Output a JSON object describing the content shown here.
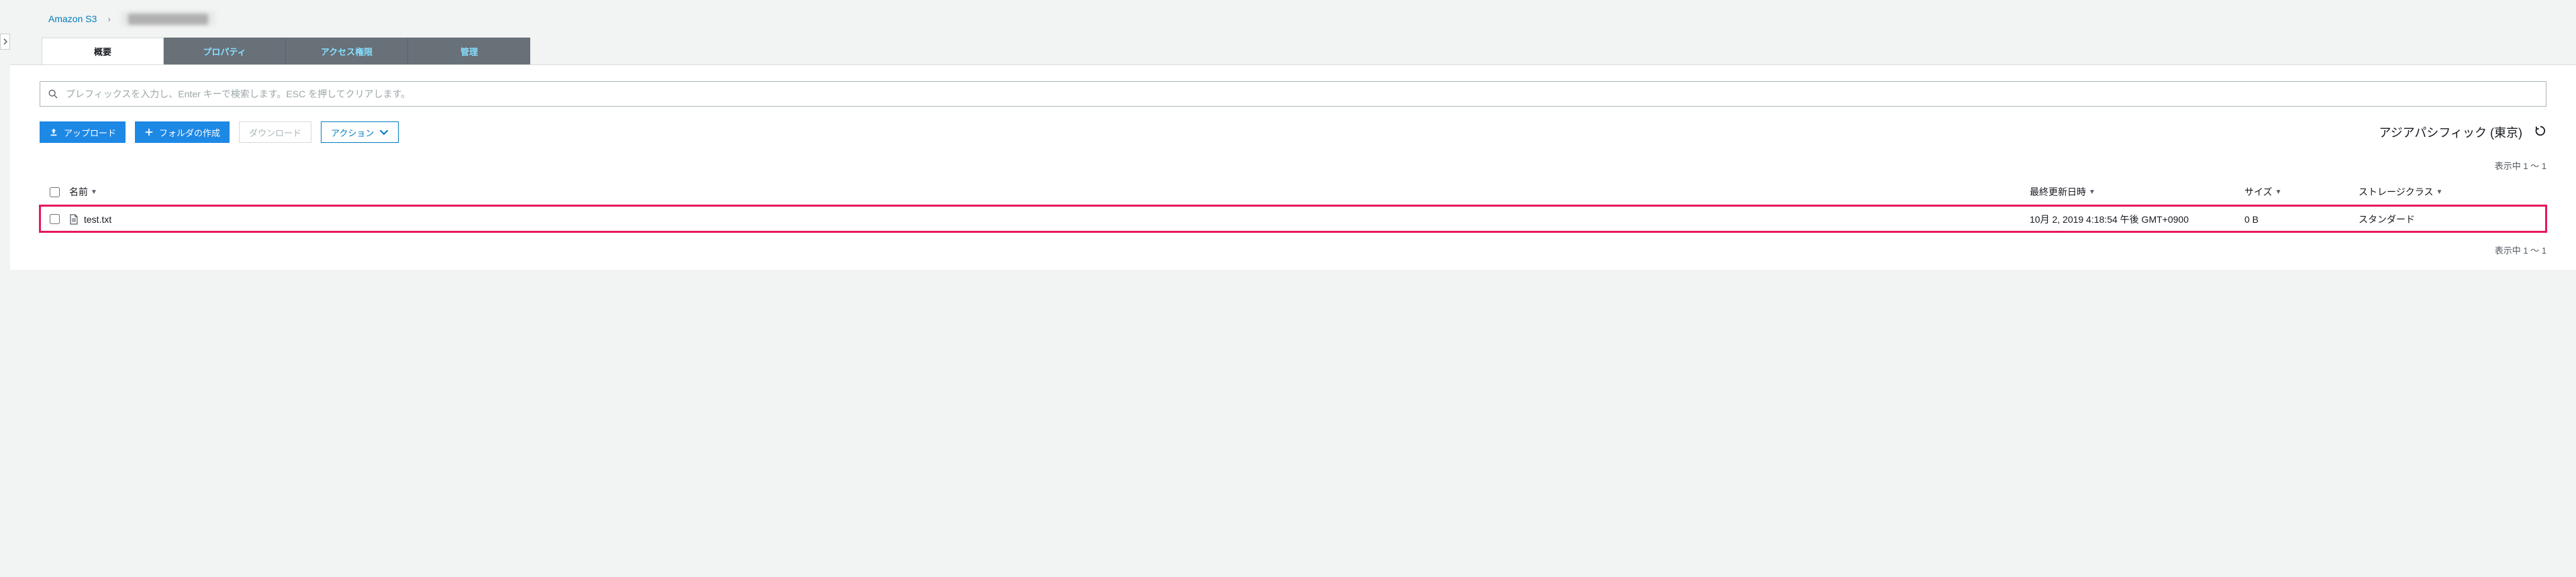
{
  "breadcrumb": {
    "root": "Amazon S3",
    "current": "████████████"
  },
  "tabs": {
    "overview": "概要",
    "properties": "プロパティ",
    "permissions": "アクセス権限",
    "management": "管理"
  },
  "search": {
    "placeholder": "プレフィックスを入力し、Enter キーで検索します。ESC を押してクリアします。"
  },
  "toolbar": {
    "upload": "アップロード",
    "create_folder": "フォルダの作成",
    "download": "ダウンロード",
    "actions": "アクション"
  },
  "region": "アジアパシフィック (東京)",
  "pagination": {
    "showing": "表示中 1 〜 1"
  },
  "columns": {
    "name": "名前",
    "last_modified": "最終更新日時",
    "size": "サイズ",
    "storage_class": "ストレージクラス"
  },
  "rows": [
    {
      "name": "test.txt",
      "last_modified": "10月 2, 2019 4:18:54 午後 GMT+0900",
      "size": "0 B",
      "storage_class": "スタンダード"
    }
  ]
}
